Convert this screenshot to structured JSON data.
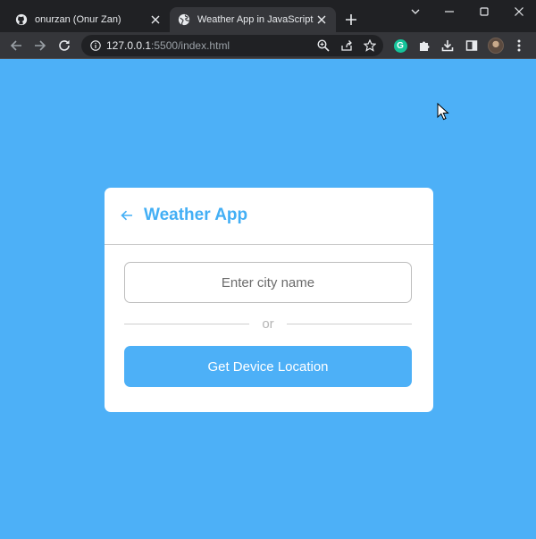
{
  "browser": {
    "tabs": [
      {
        "title": "onurzan (Onur Zan)",
        "favicon": "github-icon",
        "active": false
      },
      {
        "title": "Weather App in JavaScript",
        "favicon": "globe-icon",
        "active": true
      }
    ],
    "address": {
      "host": "127.0.0.1",
      "rest": ":5500/index.html"
    },
    "extensions": {
      "grammarly": "G"
    }
  },
  "app": {
    "title": "Weather App",
    "back_icon": "arrow-left-icon",
    "city_input": {
      "placeholder": "Enter city name",
      "value": ""
    },
    "separator_text": "or",
    "location_button": "Get Device Location"
  },
  "colors": {
    "page_background": "#4db0f7",
    "accent": "#43aff5",
    "card": "#ffffff",
    "button": "#4db0f7"
  }
}
